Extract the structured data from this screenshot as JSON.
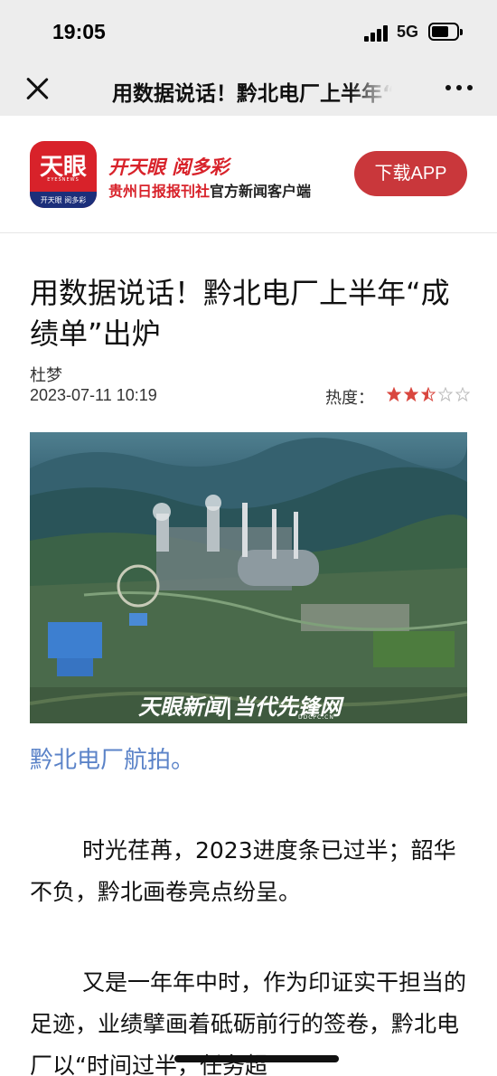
{
  "status_bar": {
    "time": "19:05",
    "network": "5G"
  },
  "nav": {
    "title": "用数据说话！黔北电厂上半年“成绩单”出炉"
  },
  "banner": {
    "logo_text": "天眼",
    "logo_en": "EYESNEWS",
    "logo_small": "开天眼 阅多彩",
    "slogan": "开天眼 阅多彩",
    "subslogan_red": "贵州日报报刊社",
    "subslogan_dark": "官方新闻客户端",
    "download_label": "下载APP",
    "accent_color": "#d8222a",
    "button_color": "#c9373b"
  },
  "article": {
    "headline": "用数据说话！黔北电厂上半年“成绩单”出炉",
    "author": "杜梦",
    "datetime": "2023-07-11 10:19",
    "heat_label": "热度：",
    "heat_rating": 2.5,
    "heat_max": 5,
    "image_watermark": "天眼新闻|当代先锋网",
    "image_watermark_sub": "DDCPC.CN",
    "caption": "黔北电厂航拍。",
    "paragraphs": [
      "时光荏苒，2023进度条已过半；韶华不负，黔北画卷亮点纷呈。",
      "又是一年年中时，作为印证实干担当的足迹，业绩擘画着砥砺前行的签卷，黔北电厂以“时间过半，任务超"
    ]
  }
}
